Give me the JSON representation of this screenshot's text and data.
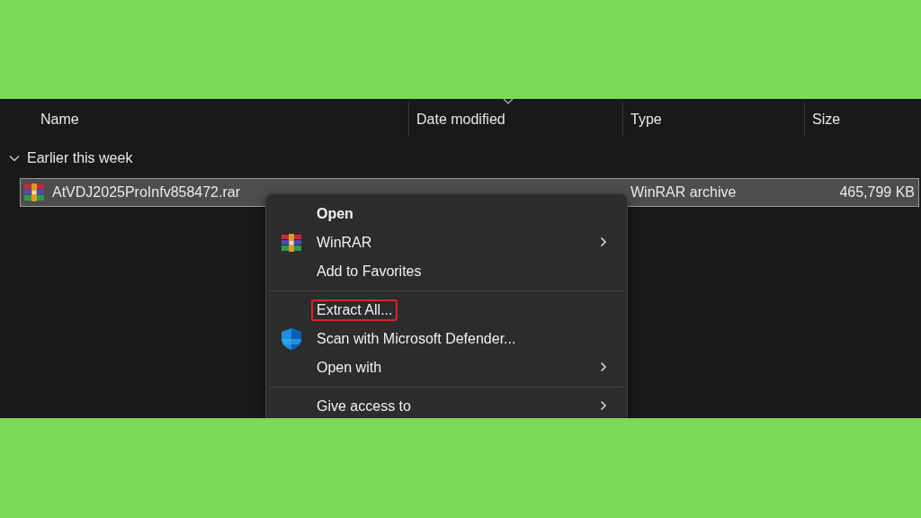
{
  "columns": [
    {
      "label": "Name",
      "sorted": false
    },
    {
      "label": "Date modified",
      "sorted": true
    },
    {
      "label": "Type",
      "sorted": false
    },
    {
      "label": "Size",
      "sorted": false
    }
  ],
  "group": {
    "label": "Earlier this week",
    "expanded": true
  },
  "files": [
    {
      "name": "AtVDJ2025ProInfv858472.rar",
      "type": "WinRAR archive",
      "size": "465,799 KB",
      "selected": true
    }
  ],
  "context_menu": [
    {
      "kind": "item",
      "label": "Open",
      "default": true,
      "submenu": false,
      "highlighted": false
    },
    {
      "kind": "item",
      "label": "WinRAR",
      "default": false,
      "submenu": true,
      "highlighted": false
    },
    {
      "kind": "item",
      "label": "Add to Favorites",
      "default": false,
      "submenu": false,
      "highlighted": false
    },
    {
      "kind": "separator"
    },
    {
      "kind": "item",
      "label": "Extract All...",
      "default": false,
      "submenu": false,
      "highlighted": true
    },
    {
      "kind": "item",
      "label": "Scan with Microsoft Defender...",
      "default": false,
      "submenu": false,
      "highlighted": false
    },
    {
      "kind": "item",
      "label": "Open with",
      "default": false,
      "submenu": true,
      "highlighted": false
    },
    {
      "kind": "separator"
    },
    {
      "kind": "item",
      "label": "Give access to",
      "default": false,
      "submenu": true,
      "highlighted": false
    }
  ]
}
